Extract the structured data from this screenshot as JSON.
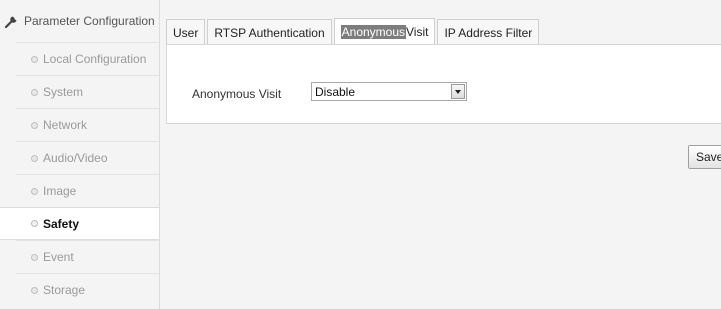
{
  "sidebar": {
    "header": "Parameter Configuration",
    "items": [
      {
        "label": "Local Configuration"
      },
      {
        "label": "System"
      },
      {
        "label": "Network"
      },
      {
        "label": "Audio/Video"
      },
      {
        "label": "Image"
      },
      {
        "label": "Safety",
        "active": true
      },
      {
        "label": "Event"
      },
      {
        "label": "Storage"
      }
    ]
  },
  "tabs": {
    "user": "User",
    "rtsp": "RTSP Authentication",
    "anonymous_highlight": "Anonymous",
    "anonymous_rest": " Visit",
    "ip_filter": "IP Address Filter"
  },
  "form": {
    "anonymous_label": "Anonymous Visit",
    "anonymous_value": "Disable"
  },
  "actions": {
    "save_label": "Save"
  },
  "colors": {
    "background": "#f4f4f4",
    "panel": "#ffffff",
    "border": "#d8d8d8",
    "highlight": "#7d7d7d"
  }
}
